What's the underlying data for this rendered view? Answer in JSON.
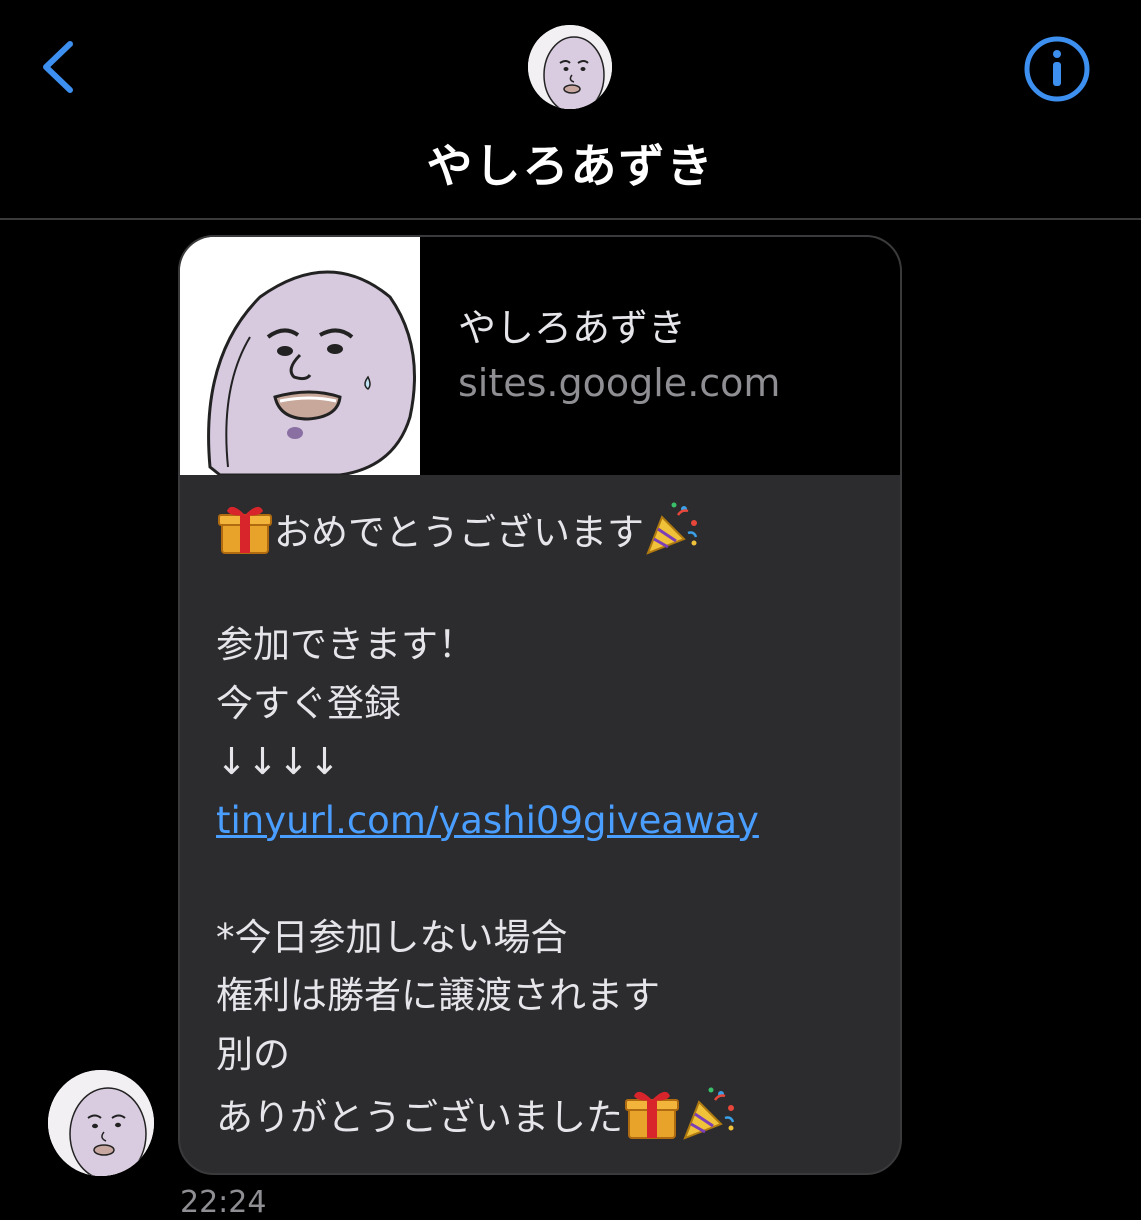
{
  "header": {
    "contact_name": "やしろあずき",
    "back_icon": "chevron-left-icon",
    "info_icon": "info-circle-icon",
    "accent_color": "#3d8ff0"
  },
  "link_preview": {
    "title": "やしろあずき",
    "domain": "sites.google.com"
  },
  "message": {
    "lines": {
      "l1_text": "おめでとうございます",
      "l1_emoji_start": "gift-emoji",
      "l1_emoji_end": "party-popper-emoji",
      "l2": "",
      "l3": "参加できます！",
      "l4": "今すぐ登録",
      "l5": "↓↓↓↓",
      "l6_link": "tinyurl.com/yashi09giveaway",
      "l7": "",
      "l8": "*今日参加しない場合",
      "l9": "権利は勝者に譲渡されます",
      "l10": "別の",
      "l11_text": "ありがとうございました",
      "l11_emoji_1": "gift-emoji",
      "l11_emoji_2": "party-popper-emoji"
    },
    "link_color": "#4a9eff",
    "bubble_color": "#2c2c2e"
  },
  "timestamp": "22:24"
}
